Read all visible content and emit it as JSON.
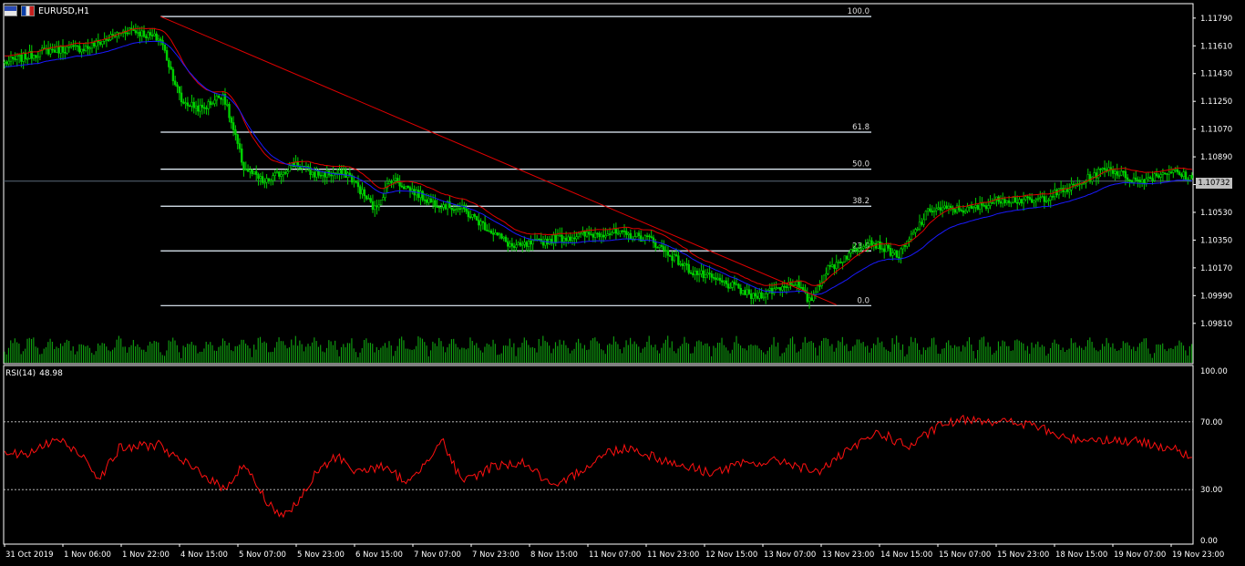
{
  "window": {
    "symbol_title": "EURUSD,H1",
    "rsi_label": "RSI(14)",
    "rsi_value": "48.98",
    "current_price": "1.10732"
  },
  "colors": {
    "background": "#000000",
    "frame": "#ffffff",
    "candle": "#00d000",
    "ma_fast": "#e00000",
    "ma_slow": "#1a1aff",
    "fib": "#e8f4ff",
    "rsi": "#ff1010",
    "volume": "#10a010"
  },
  "chart_data": [
    {
      "type": "line",
      "title": "EURUSD,H1",
      "x": [
        "31 Oct 2019",
        "1 Nov 06:00",
        "1 Nov 22:00",
        "4 Nov 15:00",
        "5 Nov 07:00",
        "5 Nov 23:00",
        "6 Nov 15:00",
        "7 Nov 07:00",
        "7 Nov 23:00",
        "8 Nov 15:00",
        "11 Nov 07:00",
        "11 Nov 23:00",
        "12 Nov 15:00",
        "13 Nov 07:00",
        "13 Nov 23:00",
        "14 Nov 15:00",
        "15 Nov 07:00",
        "15 Nov 23:00",
        "18 Nov 15:00",
        "19 Nov 07:00",
        "19 Nov 23:00"
      ],
      "ylim": [
        1.0972,
        1.1186
      ],
      "yticks": [
        "1.11790",
        "1.11610",
        "1.11430",
        "1.11250",
        "1.11070",
        "1.10890",
        "1.10710",
        "1.10530",
        "1.10350",
        "1.10170",
        "1.09990",
        "1.09810"
      ],
      "close_anchors": [
        [
          0,
          1.115
        ],
        [
          20,
          1.1158
        ],
        [
          40,
          1.116
        ],
        [
          60,
          1.1172
        ],
        [
          75,
          1.1165
        ],
        [
          85,
          1.1125
        ],
        [
          95,
          1.112
        ],
        [
          105,
          1.113
        ],
        [
          115,
          1.1082
        ],
        [
          125,
          1.1072
        ],
        [
          140,
          1.1085
        ],
        [
          148,
          1.1078
        ],
        [
          165,
          1.1078
        ],
        [
          178,
          1.1055
        ],
        [
          186,
          1.1075
        ],
        [
          205,
          1.106
        ],
        [
          220,
          1.1055
        ],
        [
          245,
          1.103
        ],
        [
          265,
          1.1036
        ],
        [
          290,
          1.104
        ],
        [
          310,
          1.1036
        ],
        [
          330,
          1.1015
        ],
        [
          350,
          1.1005
        ],
        [
          360,
          1.0998
        ],
        [
          380,
          1.1008
        ],
        [
          387,
          1.0995
        ],
        [
          395,
          1.1015
        ],
        [
          415,
          1.1035
        ],
        [
          430,
          1.1025
        ],
        [
          445,
          1.1055
        ],
        [
          465,
          1.1055
        ],
        [
          480,
          1.1062
        ],
        [
          495,
          1.106
        ],
        [
          515,
          1.107
        ],
        [
          530,
          1.1082
        ],
        [
          545,
          1.1073
        ],
        [
          560,
          1.108
        ],
        [
          571,
          1.1075
        ]
      ],
      "series": [
        {
          "name": "",
          "values": []
        }
      ],
      "fibonacci_levels": [
        {
          "label": "100.0",
          "price": 1.118
        },
        {
          "label": "61.8",
          "price": 1.1105
        },
        {
          "label": "50.0",
          "price": 1.1081
        },
        {
          "label": "38.2",
          "price": 1.1057
        },
        {
          "label": "23.6",
          "price": 1.1028
        },
        {
          "label": "0.0",
          "price": 1.09925
        }
      ],
      "trendline": [
        [
          75,
          1.118
        ],
        [
          400,
          1.0993
        ]
      ],
      "grid": false,
      "current_price": 1.10732
    },
    {
      "type": "line",
      "title": "RSI(14) 48.98",
      "ylim": [
        0,
        100
      ],
      "yticks": [
        "100.00",
        "70.00",
        "30.00",
        "0.00"
      ],
      "levels": [
        70,
        30
      ],
      "anchors": [
        [
          0,
          52
        ],
        [
          10,
          50
        ],
        [
          25,
          60
        ],
        [
          40,
          48
        ],
        [
          45,
          36
        ],
        [
          55,
          54
        ],
        [
          75,
          57
        ],
        [
          80,
          50
        ],
        [
          95,
          40
        ],
        [
          105,
          30
        ],
        [
          115,
          45
        ],
        [
          125,
          25
        ],
        [
          132,
          15
        ],
        [
          140,
          20
        ],
        [
          150,
          40
        ],
        [
          160,
          50
        ],
        [
          170,
          40
        ],
        [
          180,
          44
        ],
        [
          195,
          34
        ],
        [
          210,
          60
        ],
        [
          220,
          34
        ],
        [
          235,
          44
        ],
        [
          250,
          46
        ],
        [
          265,
          30
        ],
        [
          275,
          40
        ],
        [
          290,
          52
        ],
        [
          300,
          55
        ],
        [
          320,
          46
        ],
        [
          340,
          40
        ],
        [
          355,
          45
        ],
        [
          375,
          47
        ],
        [
          390,
          40
        ],
        [
          405,
          52
        ],
        [
          420,
          64
        ],
        [
          435,
          55
        ],
        [
          450,
          68
        ],
        [
          465,
          72
        ],
        [
          480,
          70
        ],
        [
          495,
          68
        ],
        [
          510,
          60
        ],
        [
          525,
          60
        ],
        [
          545,
          58
        ],
        [
          560,
          55
        ],
        [
          571,
          48.98
        ]
      ],
      "current": 48.98
    }
  ]
}
